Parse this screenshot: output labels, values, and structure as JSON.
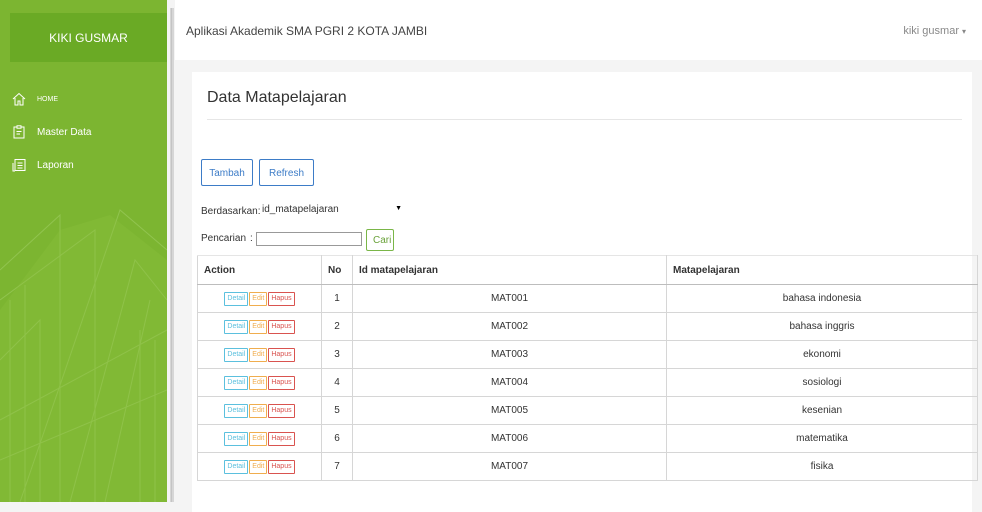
{
  "sidebar": {
    "brand": "KIKI GUSMAR",
    "items": [
      {
        "label": "HOME",
        "icon": "home-icon"
      },
      {
        "label": "Master Data",
        "icon": "clipboard-icon"
      },
      {
        "label": "Laporan",
        "icon": "report-icon"
      }
    ]
  },
  "header": {
    "app_title": "Aplikasi Akademik SMA PGRI 2 KOTA JAMBI",
    "user": "kiki gusmar",
    "user_caret": "▾"
  },
  "main": {
    "title": "Data Matapelajaran",
    "buttons": {
      "tambah": "Tambah",
      "refresh": "Refresh"
    },
    "filter": {
      "label": "Berdasarkan:",
      "selected": "id_matapelajaran",
      "arrow": "▼"
    },
    "search": {
      "label": "Pencarian",
      "colon": ":",
      "value": "",
      "button": "Cari"
    },
    "table": {
      "headers": [
        "Action",
        "No",
        "Id matapelajaran",
        "Matapelajaran"
      ],
      "action_labels": {
        "detail": "Detail",
        "edit": "Edit",
        "hapus": "Hapus"
      },
      "rows": [
        {
          "no": "1",
          "id": "MAT001",
          "nama": "bahasa indonesia"
        },
        {
          "no": "2",
          "id": "MAT002",
          "nama": "bahasa inggris"
        },
        {
          "no": "3",
          "id": "MAT003",
          "nama": "ekonomi"
        },
        {
          "no": "4",
          "id": "MAT004",
          "nama": "sosiologi"
        },
        {
          "no": "5",
          "id": "MAT005",
          "nama": "kesenian"
        },
        {
          "no": "6",
          "id": "MAT006",
          "nama": "matematika"
        },
        {
          "no": "7",
          "id": "MAT007",
          "nama": "fisika"
        }
      ]
    }
  },
  "colors": {
    "sidebar": "#7cb531",
    "brand": "#6aaa25",
    "primary": "#3d7cc7",
    "success": "#6aa23a",
    "info": "#5bc0de",
    "warning": "#f0ad4e",
    "danger": "#d9534f"
  }
}
